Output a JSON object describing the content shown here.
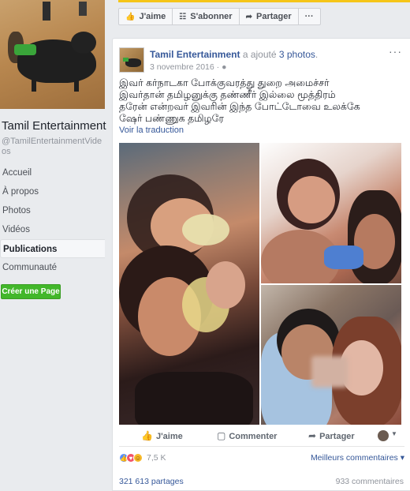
{
  "sidebar": {
    "page_name": "Tamil Entertainment",
    "page_handle": "@TamilEntertainmentVideos",
    "nav": [
      {
        "label": "Accueil"
      },
      {
        "label": "À propos"
      },
      {
        "label": "Photos"
      },
      {
        "label": "Vidéos"
      },
      {
        "label": "Publications",
        "active": true
      },
      {
        "label": "Communauté"
      }
    ],
    "create_page_label": "Créer une Page"
  },
  "actionbar": {
    "like_label": "J'aime",
    "subscribe_label": "S'abonner",
    "share_label": "Partager",
    "more_label": "···"
  },
  "post": {
    "author": "Tamil Entertainment",
    "verb": "a ajouté",
    "photos_link": "3 photos",
    "date": "3 novembre 2016",
    "privacy_icon": "globe-icon",
    "text": "இவர் கர்நாடகா போக்குவரத்து துறை அமைச்சர்\nஇவர்தான் தமிழனுக்கு தண்ணீர் இல்லை மூத்திரம்\nதரேன் என்றவர் இவரின் இந்த போட்டோவை உலக்கே\nஷேர் பண்ணுக தமிழரே",
    "translate_label": "Voir la traduction",
    "actions": {
      "like": "J'aime",
      "comment": "Commenter",
      "share": "Partager"
    },
    "reaction_count": "7,5 K",
    "best_comments_label": "Meilleurs commentaires ▾",
    "shares": "321 613 partages",
    "comments": "933 commentaires"
  },
  "colors": {
    "link": "#365899",
    "create_button": "#42b72a",
    "like_reaction": "#5890ff",
    "love_reaction": "#f25268",
    "haha_reaction": "#f7b928"
  }
}
